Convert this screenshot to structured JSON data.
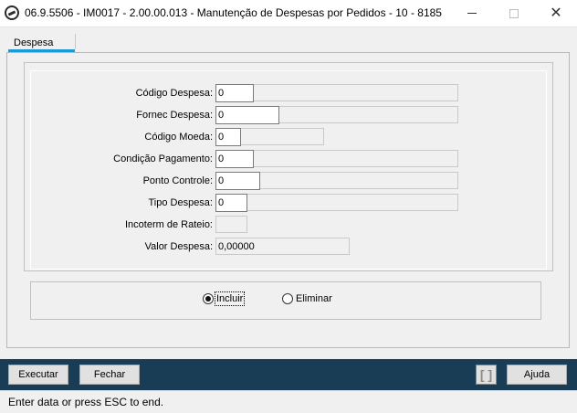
{
  "window": {
    "title": "06.9.5506 - IM0017 - 2.00.00.013 - Manutenção de Despesas por Pedidos - 10 - 8185",
    "minimize": "—",
    "maximize": "☐",
    "close": "✕"
  },
  "tabs": [
    {
      "label": "Despesa",
      "active": true
    }
  ],
  "form": {
    "codigo_despesa": {
      "label": "Código Despesa:",
      "value": "0"
    },
    "fornec_despesa": {
      "label": "Fornec Despesa:",
      "value": "0"
    },
    "codigo_moeda": {
      "label": "Código Moeda:",
      "value": "0"
    },
    "condicao_pagamento": {
      "label": "Condição Pagamento:",
      "value": "0"
    },
    "ponto_controle": {
      "label": "Ponto Controle:",
      "value": "0"
    },
    "tipo_despesa": {
      "label": "Tipo Despesa:",
      "value": "0"
    },
    "incoterm_rateio": {
      "label": "Incoterm de Rateio:",
      "value": ""
    },
    "valor_despesa": {
      "label": "Valor Despesa:",
      "value": "0,00000"
    }
  },
  "radios": {
    "incluir": {
      "label": "Incluir",
      "selected": true
    },
    "eliminar": {
      "label": "Eliminar",
      "selected": false
    }
  },
  "toolbar": {
    "executar": "Executar",
    "fechar": "Fechar",
    "grip": "[ ]",
    "ajuda": "Ajuda"
  },
  "status": {
    "text": "Enter data or press ESC to end."
  },
  "colors": {
    "toolbar_bg": "#183d54",
    "tab_accent": "#1c9ad6"
  }
}
